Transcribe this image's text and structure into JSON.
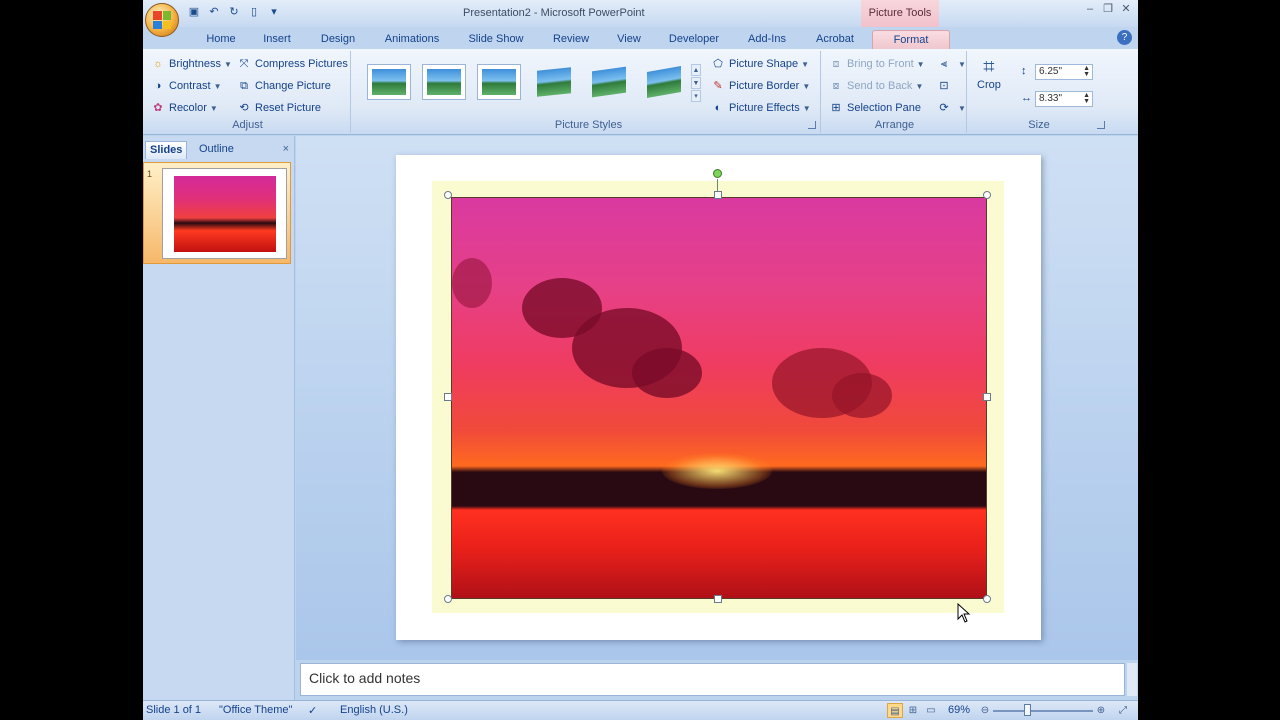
{
  "window": {
    "title": "Presentation2 - Microsoft PowerPoint",
    "context_tab_title": "Picture Tools"
  },
  "tabs": [
    {
      "label": "Home",
      "w": 50
    },
    {
      "label": "Insert",
      "w": 62
    },
    {
      "label": "Design",
      "w": 60
    },
    {
      "label": "Animations",
      "w": 88
    },
    {
      "label": "Slide Show",
      "w": 80
    },
    {
      "label": "Review",
      "w": 70
    },
    {
      "label": "View",
      "w": 46
    },
    {
      "label": "Developer",
      "w": 84
    },
    {
      "label": "Add-Ins",
      "w": 62
    },
    {
      "label": "Acrobat",
      "w": 74
    },
    {
      "label": "Format",
      "w": 78
    }
  ],
  "ribbon": {
    "adjust": {
      "label": "Adjust",
      "brightness": "Brightness",
      "contrast": "Contrast",
      "recolor": "Recolor",
      "compress": "Compress Pictures",
      "change": "Change Picture",
      "reset": "Reset Picture"
    },
    "picture_styles": {
      "label": "Picture Styles",
      "shape": "Picture Shape",
      "border": "Picture Border",
      "effects": "Picture Effects"
    },
    "arrange": {
      "label": "Arrange",
      "bring_front": "Bring to Front",
      "send_back": "Send to Back",
      "selection_pane": "Selection Pane"
    },
    "size": {
      "label": "Size",
      "crop": "Crop",
      "height": "6.25\"",
      "width": "8.33\""
    }
  },
  "slides_pane": {
    "tab_slides": "Slides",
    "tab_outline": "Outline",
    "close": "×",
    "slide_number": "1"
  },
  "notes": {
    "placeholder": "Click to add notes"
  },
  "status": {
    "slide": "Slide 1 of 1",
    "theme": "\"Office Theme\"",
    "language": "English (U.S.)",
    "zoom": "69%"
  },
  "colors": {
    "accent_tab": "#f7cfa0",
    "context_tab": "#f2c2cc"
  }
}
